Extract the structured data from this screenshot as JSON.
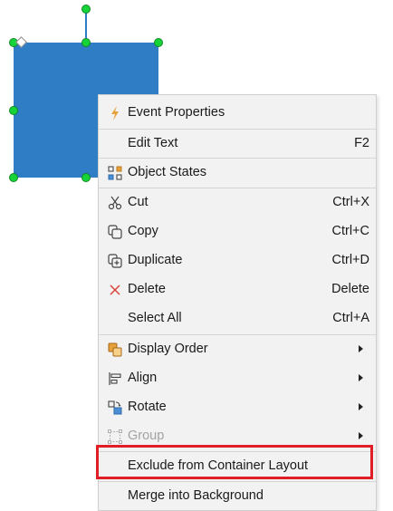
{
  "menu": {
    "items": [
      {
        "label": "Event Properties",
        "shortcut": "",
        "icon": "lightning-icon",
        "submenu": false,
        "disabled": false
      },
      {
        "label": "Edit Text",
        "shortcut": "F2",
        "icon": "",
        "submenu": false,
        "disabled": false
      },
      {
        "label": "Object States",
        "shortcut": "",
        "icon": "object-states-icon",
        "submenu": false,
        "disabled": false
      },
      {
        "label": "Cut",
        "shortcut": "Ctrl+X",
        "icon": "scissors-icon",
        "submenu": false,
        "disabled": false
      },
      {
        "label": "Copy",
        "shortcut": "Ctrl+C",
        "icon": "copy-icon",
        "submenu": false,
        "disabled": false
      },
      {
        "label": "Duplicate",
        "shortcut": "Ctrl+D",
        "icon": "duplicate-icon",
        "submenu": false,
        "disabled": false
      },
      {
        "label": "Delete",
        "shortcut": "Delete",
        "icon": "x-icon",
        "submenu": false,
        "disabled": false
      },
      {
        "label": "Select All",
        "shortcut": "Ctrl+A",
        "icon": "",
        "submenu": false,
        "disabled": false
      },
      {
        "label": "Display Order",
        "shortcut": "",
        "icon": "display-order-icon",
        "submenu": true,
        "disabled": false
      },
      {
        "label": "Align",
        "shortcut": "",
        "icon": "align-icon",
        "submenu": true,
        "disabled": false
      },
      {
        "label": "Rotate",
        "shortcut": "",
        "icon": "rotate-icon",
        "submenu": true,
        "disabled": false
      },
      {
        "label": "Group",
        "shortcut": "",
        "icon": "group-icon",
        "submenu": true,
        "disabled": true
      },
      {
        "label": "Exclude from Container Layout",
        "shortcut": "",
        "icon": "",
        "submenu": false,
        "disabled": false
      },
      {
        "label": "Merge into Background",
        "shortcut": "",
        "icon": "",
        "submenu": false,
        "disabled": false
      }
    ]
  },
  "colors": {
    "shape_fill": "#2f7dc5",
    "handle": "#16d338",
    "menu_bg": "#f2f2f2",
    "highlight": "#e01e26",
    "lightning": "#e8a03a",
    "delete_x": "#d9413a"
  }
}
